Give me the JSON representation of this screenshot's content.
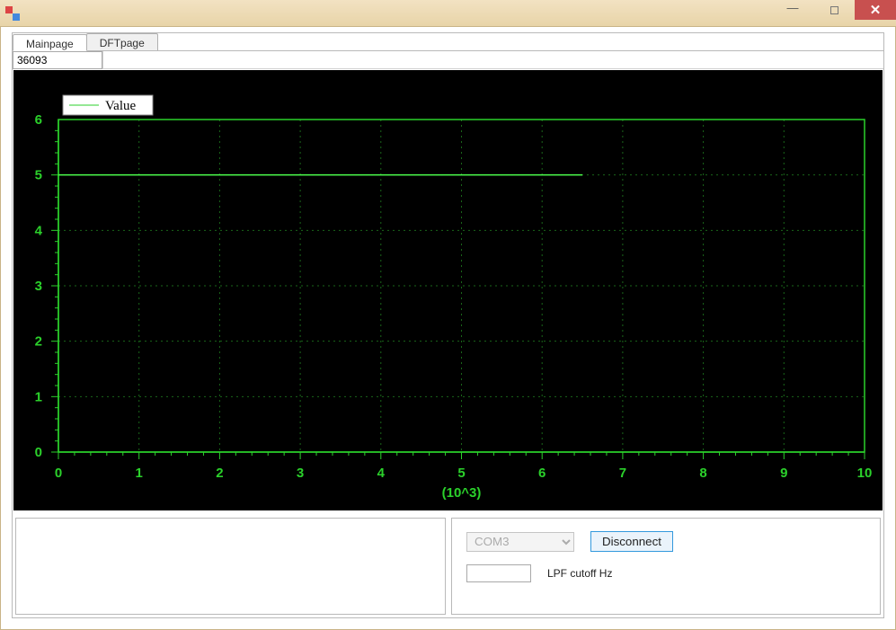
{
  "window": {
    "title": ""
  },
  "tabs": [
    {
      "label": "Mainpage",
      "active": true
    },
    {
      "label": "DFTpage",
      "active": false
    }
  ],
  "value_display": "36093",
  "chart_data": {
    "type": "line",
    "x_unit_label": "(10^3)",
    "xrange": [
      0,
      10
    ],
    "yrange": [
      0,
      6
    ],
    "xticks": [
      0,
      1,
      2,
      3,
      4,
      5,
      6,
      7,
      8,
      9,
      10
    ],
    "yticks": [
      0,
      1,
      2,
      3,
      4,
      5,
      6
    ],
    "legend": {
      "label": "Value"
    },
    "series": [
      {
        "name": "Value",
        "points": [
          [
            0,
            5
          ],
          [
            6.5,
            5
          ]
        ]
      }
    ]
  },
  "controls": {
    "com_port": {
      "selected": "COM3",
      "options": [
        "COM3"
      ],
      "enabled": false
    },
    "connect_button": "Disconnect",
    "lpf_value": "",
    "lpf_label": "LPF cutoff Hz"
  },
  "win_buttons": {
    "min": "—",
    "max": "▢",
    "close": "✕"
  }
}
